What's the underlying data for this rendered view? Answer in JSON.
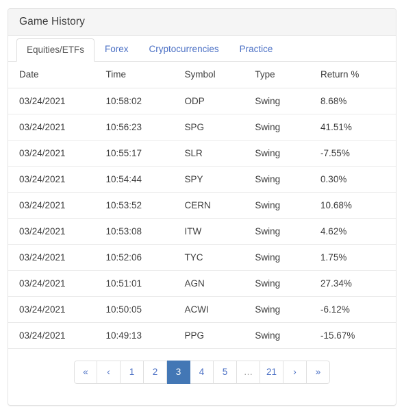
{
  "card": {
    "title": "Game History"
  },
  "tabs": [
    {
      "label": "Equities/ETFs",
      "active": true
    },
    {
      "label": "Forex",
      "active": false
    },
    {
      "label": "Cryptocurrencies",
      "active": false
    },
    {
      "label": "Practice",
      "active": false
    }
  ],
  "table": {
    "columns": [
      "Date",
      "Time",
      "Symbol",
      "Type",
      "Return %"
    ],
    "rows": [
      {
        "date": "03/24/2021",
        "time": "10:58:02",
        "symbol": "ODP",
        "type": "Swing",
        "return": "8.68%",
        "sign": "pos"
      },
      {
        "date": "03/24/2021",
        "time": "10:56:23",
        "symbol": "SPG",
        "type": "Swing",
        "return": "41.51%",
        "sign": "pos"
      },
      {
        "date": "03/24/2021",
        "time": "10:55:17",
        "symbol": "SLR",
        "type": "Swing",
        "return": "-7.55%",
        "sign": "neg"
      },
      {
        "date": "03/24/2021",
        "time": "10:54:44",
        "symbol": "SPY",
        "type": "Swing",
        "return": "0.30%",
        "sign": "pos"
      },
      {
        "date": "03/24/2021",
        "time": "10:53:52",
        "symbol": "CERN",
        "type": "Swing",
        "return": "10.68%",
        "sign": "pos"
      },
      {
        "date": "03/24/2021",
        "time": "10:53:08",
        "symbol": "ITW",
        "type": "Swing",
        "return": "4.62%",
        "sign": "pos"
      },
      {
        "date": "03/24/2021",
        "time": "10:52:06",
        "symbol": "TYC",
        "type": "Swing",
        "return": "1.75%",
        "sign": "pos"
      },
      {
        "date": "03/24/2021",
        "time": "10:51:01",
        "symbol": "AGN",
        "type": "Swing",
        "return": "27.34%",
        "sign": "pos"
      },
      {
        "date": "03/24/2021",
        "time": "10:50:05",
        "symbol": "ACWI",
        "type": "Swing",
        "return": "-6.12%",
        "sign": "neg"
      },
      {
        "date": "03/24/2021",
        "time": "10:49:13",
        "symbol": "PPG",
        "type": "Swing",
        "return": "-15.67%",
        "sign": "neg"
      }
    ]
  },
  "pagination": {
    "current_page": "3",
    "items": [
      {
        "label": "«",
        "name": "first",
        "active": false,
        "ellipsis": false
      },
      {
        "label": "‹",
        "name": "previous",
        "active": false,
        "ellipsis": false
      },
      {
        "label": "1",
        "name": "page-1",
        "active": false,
        "ellipsis": false
      },
      {
        "label": "2",
        "name": "page-2",
        "active": false,
        "ellipsis": false
      },
      {
        "label": "3",
        "name": "page-3",
        "active": true,
        "ellipsis": false
      },
      {
        "label": "4",
        "name": "page-4",
        "active": false,
        "ellipsis": false
      },
      {
        "label": "5",
        "name": "page-5",
        "active": false,
        "ellipsis": false
      },
      {
        "label": "…",
        "name": "gap",
        "active": false,
        "ellipsis": true
      },
      {
        "label": "21",
        "name": "page-21",
        "active": false,
        "ellipsis": false
      },
      {
        "label": "›",
        "name": "next",
        "active": false,
        "ellipsis": false
      },
      {
        "label": "»",
        "name": "last",
        "active": false,
        "ellipsis": false
      }
    ]
  },
  "colors": {
    "accent": "#4377b5",
    "link": "#4a6fc4",
    "positive": "#2e7d32",
    "negative": "#e23a3a",
    "border": "#e3e3e3",
    "header_bg": "#f5f5f5"
  }
}
